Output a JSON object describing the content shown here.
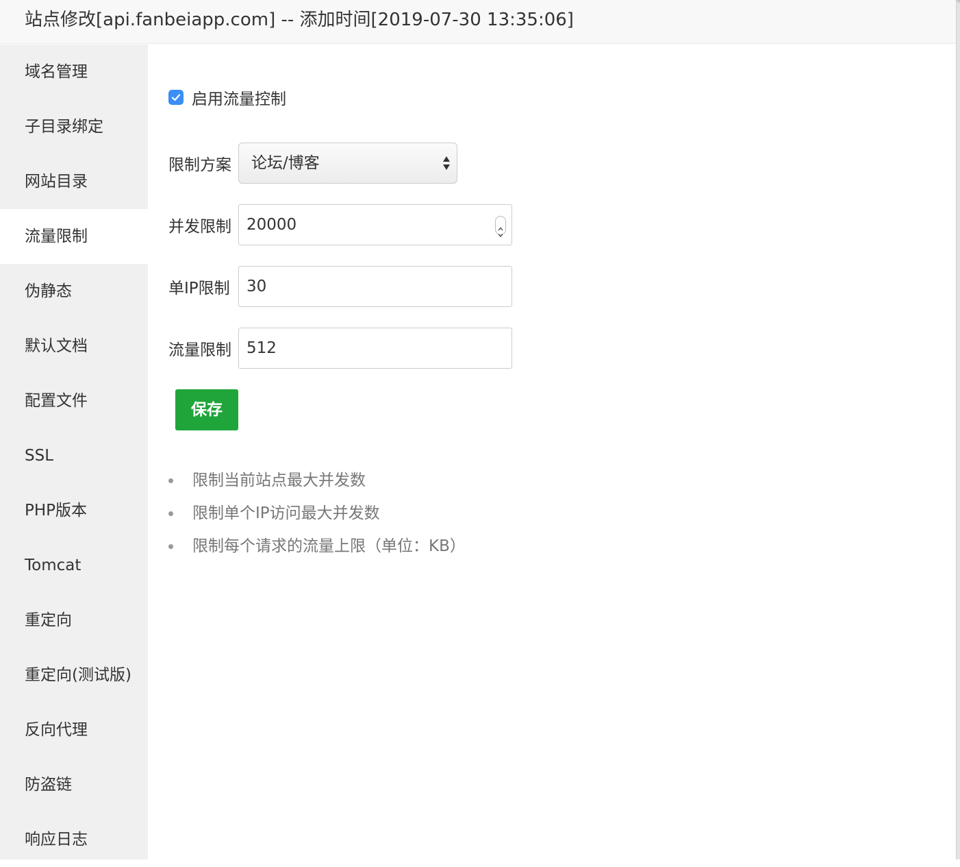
{
  "window": {
    "title": "站点修改[api.fanbeiapp.com] -- 添加时间[2019-07-30 13:35:06]"
  },
  "sidebar": {
    "items": [
      {
        "label": "域名管理"
      },
      {
        "label": "子目录绑定"
      },
      {
        "label": "网站目录"
      },
      {
        "label": "流量限制",
        "active": true
      },
      {
        "label": "伪静态"
      },
      {
        "label": "默认文档"
      },
      {
        "label": "配置文件"
      },
      {
        "label": "SSL"
      },
      {
        "label": "PHP版本"
      },
      {
        "label": "Tomcat"
      },
      {
        "label": "重定向"
      },
      {
        "label": "重定向(测试版)"
      },
      {
        "label": "反向代理"
      },
      {
        "label": "防盗链"
      },
      {
        "label": "响应日志"
      }
    ]
  },
  "form": {
    "enable_label": "启用流量控制",
    "enable_checked": true,
    "plan_label": "限制方案",
    "plan_value": "论坛/博客",
    "concurrent_label": "并发限制",
    "concurrent_value": "20000",
    "per_ip_label": "单IP限制",
    "per_ip_value": "30",
    "traffic_label": "流量限制",
    "traffic_value": "512",
    "save_label": "保存"
  },
  "tips": [
    "限制当前站点最大并发数",
    "限制单个IP访问最大并发数",
    "限制每个请求的流量上限（单位：KB）"
  ],
  "colors": {
    "accent_green": "#20a53a",
    "checkbox_blue": "#3a8ef6",
    "sidebar_bg": "#f0f0f0"
  }
}
